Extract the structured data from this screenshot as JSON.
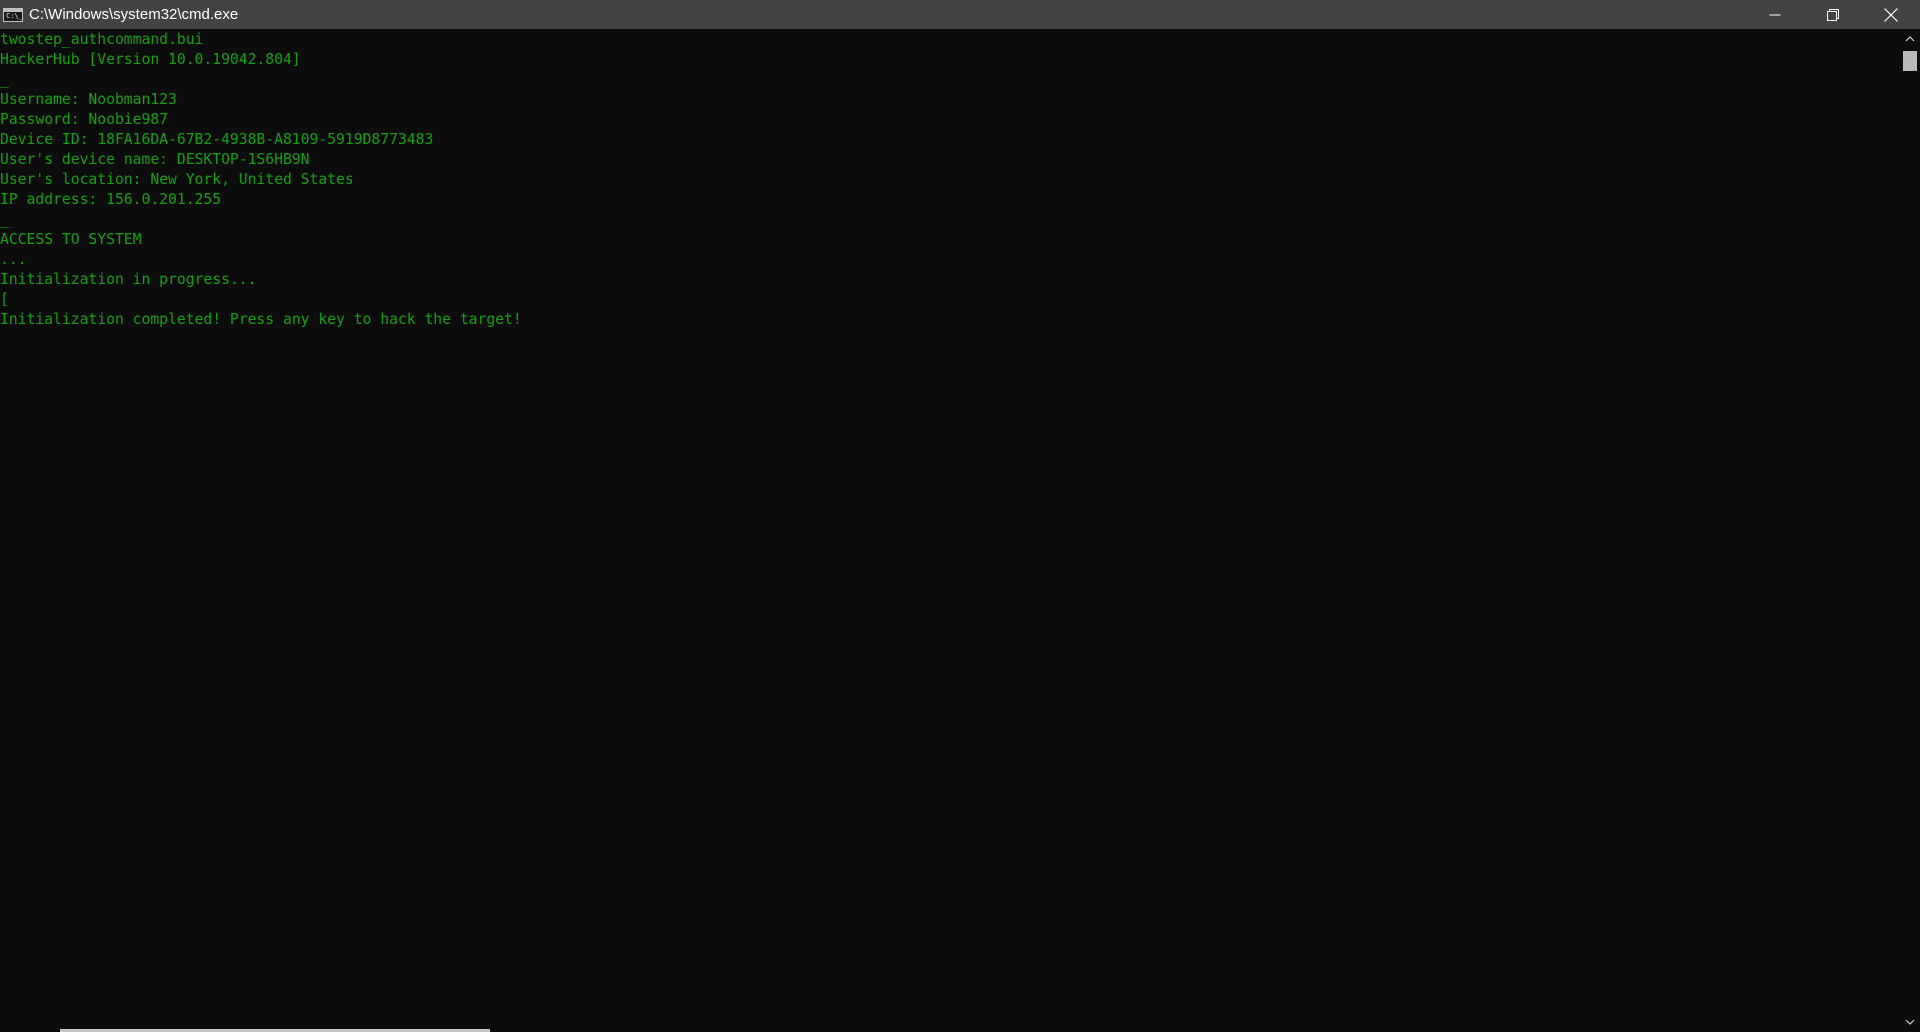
{
  "window": {
    "title": "C:\\Windows\\system32\\cmd.exe",
    "icon": "cmd-icon",
    "icon_glyph": "C:\\_"
  },
  "controls": {
    "minimize_icon": "minimize-icon",
    "restore_icon": "restore-icon",
    "close_icon": "close-icon"
  },
  "console": {
    "text_color": "#13a10e",
    "background": "#0c0c0c",
    "lines": [
      "twostep_authcommand.bui",
      "HackerHub [Version 10.0.19042.804]",
      "_",
      "Username: Noobman123",
      "Password: Noobie987",
      "Device ID: 18FA16DA-67B2-4938B-A8109-5919D8773483",
      "User's device name: DESKTOP-1S6HB9N",
      "User's location: New York, United States",
      "IP address: 156.0.201.255",
      "_",
      "ACCESS TO SYSTEM",
      "...",
      "Initialization in progress...",
      "[",
      "Initialization completed! Press any key to hack the target!"
    ]
  },
  "scrollbar": {
    "up_icon": "scroll-up-arrow-icon",
    "down_icon": "scroll-down-arrow-icon"
  }
}
